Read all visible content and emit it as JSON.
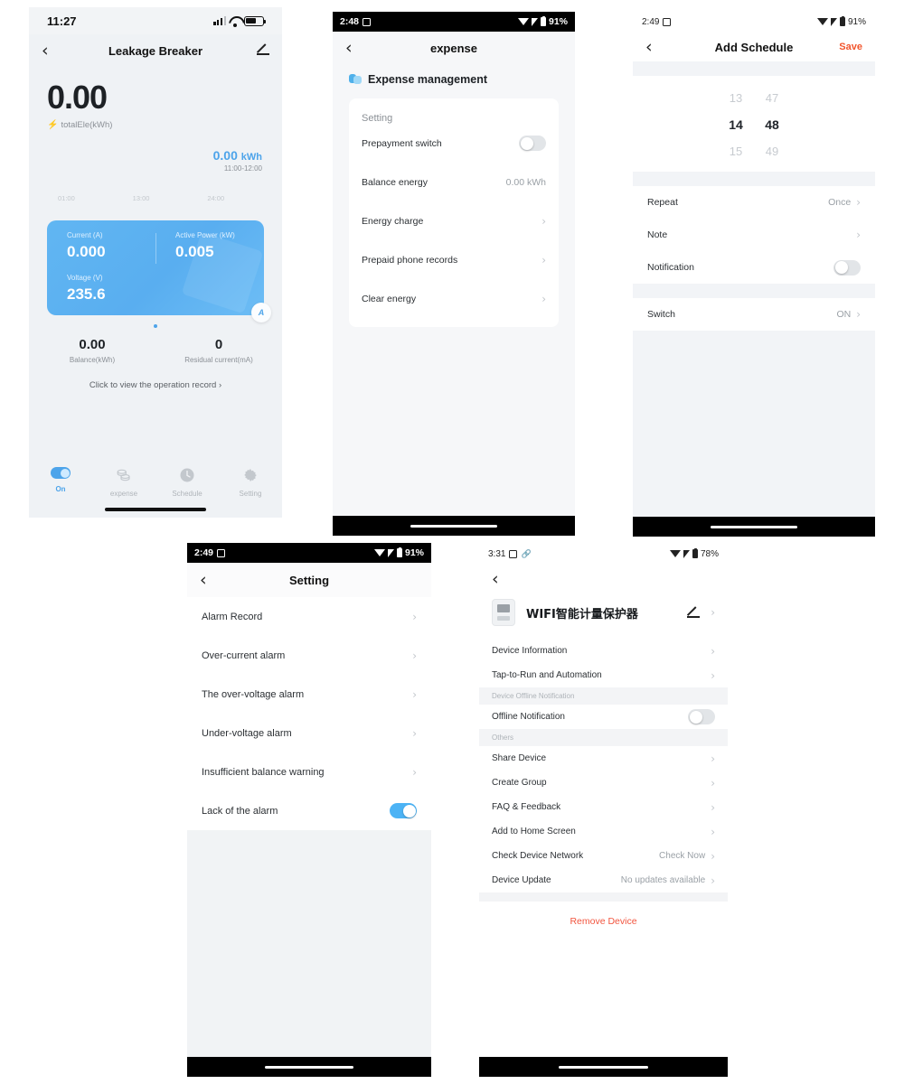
{
  "phone1": {
    "status": {
      "time": "11:27",
      "signal_icon": "cellular-bars-icon",
      "wifi_icon": "wifi-icon",
      "battery_icon": "battery-icon"
    },
    "nav": {
      "back_icon": "chevron-left-icon",
      "title": "Leakage Breaker",
      "edit_icon": "pencil-icon"
    },
    "hero": {
      "value": "0.00",
      "bolt_icon": "bolt-icon",
      "label": "totalEle(kWh)"
    },
    "chart": {
      "value": "0.00",
      "unit": "kWh",
      "range": "11:00-12:00",
      "ticks": [
        "01:00",
        "13:00",
        "24:00"
      ]
    },
    "card": {
      "current_label": "Current (A)",
      "current_value": "0.000",
      "power_label": "Active Power (kW)",
      "power_value": "0.005",
      "voltage_label": "Voltage (V)",
      "voltage_value": "235.6",
      "badge": "A"
    },
    "stats": [
      {
        "value": "0.00",
        "label": "Balance(kWh)"
      },
      {
        "value": "0",
        "label": "Residual current(mA)"
      }
    ],
    "operation_record": "Click to view the operation record ›",
    "tabs": [
      {
        "label": "On",
        "icon": "toggle-switch-icon",
        "active": true
      },
      {
        "label": "expense",
        "icon": "coins-icon",
        "active": false
      },
      {
        "label": "Schedule",
        "icon": "clock-icon",
        "active": false
      },
      {
        "label": "Setting",
        "icon": "gear-icon",
        "active": false
      }
    ]
  },
  "phone2": {
    "status": {
      "time": "2:48",
      "sd_icon": "sd-card-icon",
      "wifi_icon": "wifi-icon",
      "signal_icon": "signal-icon",
      "battery_icon": "battery-icon",
      "battery": "91%"
    },
    "nav": {
      "back_icon": "chevron-left-icon",
      "title": "expense"
    },
    "section": {
      "icon": "coins-icon",
      "title": "Expense management"
    },
    "panel_header": "Setting",
    "rows": [
      {
        "label": "Prepayment switch",
        "type": "toggle",
        "on": false
      },
      {
        "label": "Balance energy",
        "type": "value",
        "value": "0.00 kWh"
      },
      {
        "label": "Energy charge",
        "type": "chevron"
      },
      {
        "label": "Prepaid phone records",
        "type": "chevron"
      },
      {
        "label": "Clear energy",
        "type": "chevron"
      }
    ]
  },
  "phone3": {
    "status": {
      "time": "2:49",
      "sd_icon": "sd-card-icon",
      "wifi_icon": "wifi-icon",
      "signal_icon": "signal-icon",
      "battery_icon": "battery-icon",
      "battery": "91%"
    },
    "nav": {
      "back_icon": "chevron-left-icon",
      "title": "Add Schedule",
      "save": "Save",
      "save_color": "#f2552c"
    },
    "picker": {
      "rows": [
        {
          "hour": "13",
          "minute": "47",
          "selected": false
        },
        {
          "hour": "14",
          "minute": "48",
          "selected": true
        },
        {
          "hour": "15",
          "minute": "49",
          "selected": false
        }
      ]
    },
    "rows_group1": [
      {
        "label": "Repeat",
        "type": "value-chevron",
        "value": "Once"
      },
      {
        "label": "Note",
        "type": "chevron",
        "value": ""
      },
      {
        "label": "Notification",
        "type": "toggle",
        "on": false
      }
    ],
    "rows_group2": [
      {
        "label": "Switch",
        "type": "value-chevron",
        "value": "ON"
      }
    ]
  },
  "phone4": {
    "status": {
      "time": "2:49",
      "sd_icon": "sd-card-icon",
      "wifi_icon": "wifi-icon",
      "signal_icon": "signal-icon",
      "battery_icon": "battery-icon",
      "battery": "91%"
    },
    "nav": {
      "back_icon": "chevron-left-icon",
      "title": "Setting"
    },
    "rows": [
      {
        "label": "Alarm Record",
        "type": "chevron"
      },
      {
        "label": "Over-current alarm",
        "type": "chevron"
      },
      {
        "label": "The over-voltage alarm",
        "type": "chevron"
      },
      {
        "label": "Under-voltage alarm",
        "type": "chevron"
      },
      {
        "label": "Insufficient balance warning",
        "type": "chevron"
      },
      {
        "label": "Lack of the alarm",
        "type": "toggle",
        "on": true
      }
    ]
  },
  "phone5": {
    "status": {
      "time": "3:31",
      "sd_icon": "sd-card-icon",
      "link_icon": "link-icon",
      "wifi_icon": "wifi-icon",
      "signal_icon": "signal-icon",
      "battery_icon": "battery-icon",
      "battery": "78%"
    },
    "nav": {
      "back_icon": "chevron-left-icon"
    },
    "device": {
      "icon": "device-meter-icon",
      "name": "WIFI智能计量保护器",
      "edit_icon": "pencil-icon"
    },
    "rows_top": [
      {
        "label": "Device Information",
        "type": "chevron"
      },
      {
        "label": "Tap-to-Run and Automation",
        "type": "chevron"
      }
    ],
    "group1_header": "Device Offline Notification",
    "rows_group1": [
      {
        "label": "Offline Notification",
        "type": "toggle",
        "on": false
      }
    ],
    "group2_header": "Others",
    "rows_group2": [
      {
        "label": "Share Device",
        "type": "chevron"
      },
      {
        "label": "Create Group",
        "type": "chevron"
      },
      {
        "label": "FAQ & Feedback",
        "type": "chevron"
      },
      {
        "label": "Add to Home Screen",
        "type": "chevron"
      },
      {
        "label": "Check Device Network",
        "type": "value-chevron",
        "value": "Check Now"
      },
      {
        "label": "Device Update",
        "type": "value-chevron",
        "value": "No updates available"
      }
    ],
    "remove": {
      "label": "Remove Device",
      "color": "#f2553f"
    }
  }
}
